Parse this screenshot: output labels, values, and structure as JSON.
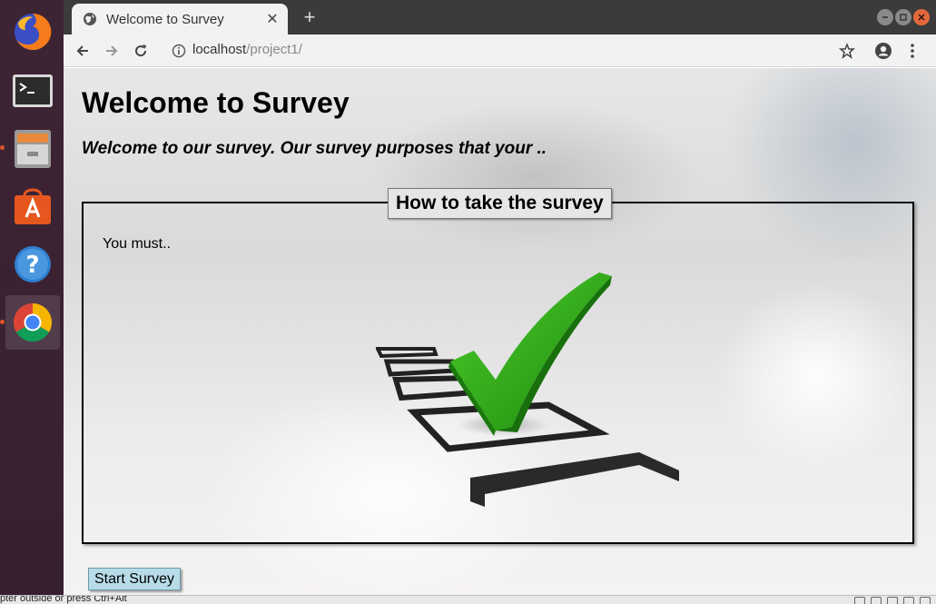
{
  "launcher": {
    "items": [
      {
        "name": "firefox",
        "running": false
      },
      {
        "name": "terminal",
        "running": false
      },
      {
        "name": "files",
        "running": true
      },
      {
        "name": "software-center",
        "running": false
      },
      {
        "name": "help",
        "running": false
      },
      {
        "name": "chrome",
        "running": true,
        "active": true
      }
    ]
  },
  "browser": {
    "tab_title": "Welcome to Survey",
    "tab_close": "✕",
    "new_tab": "+",
    "url_host": "localhost",
    "url_path": "/project1/"
  },
  "page": {
    "title": "Welcome to Survey",
    "subtitle": "Welcome to our survey. Our survey purposes that your ..",
    "fieldset_legend": "How to take the survey",
    "fieldset_text": "You must..",
    "start_button": "Start Survey"
  },
  "statusbar": {
    "text": "pter outside or press Ctrl+Alt"
  },
  "colors": {
    "launcher_bg": "#3d2434",
    "titlebar_bg": "#3b3b3b",
    "toolbar_bg": "#f2f2f2",
    "start_button_bg": "#b7dce8",
    "check_green": "#2aa415",
    "running_dot": "#e0542a"
  }
}
